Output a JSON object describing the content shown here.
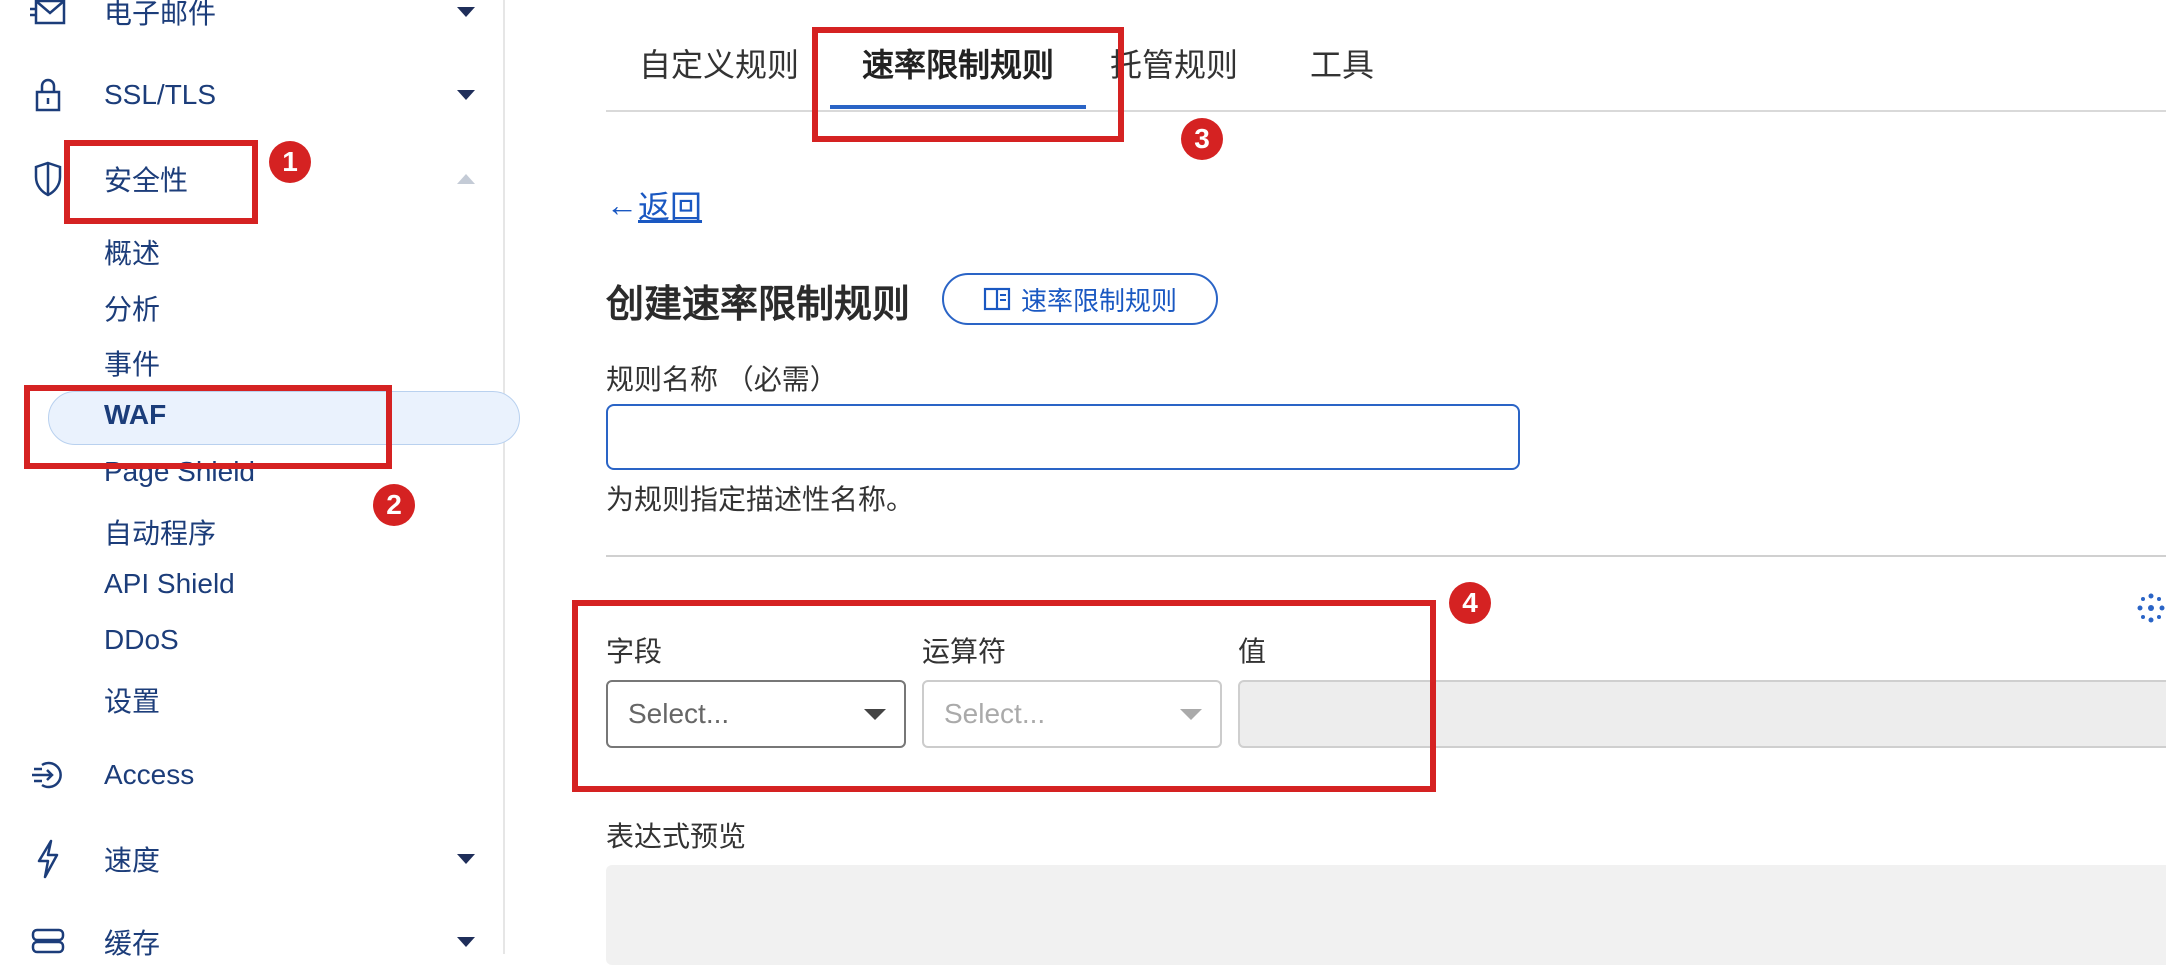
{
  "sidebar": {
    "items": [
      {
        "label": "电子邮件",
        "icon": "mail-icon"
      },
      {
        "label": "SSL/TLS",
        "icon": "lock-icon"
      },
      {
        "label": "安全性",
        "icon": "shield-icon"
      },
      {
        "label": "Access",
        "icon": "access-icon"
      },
      {
        "label": "速度",
        "icon": "lightning-icon"
      },
      {
        "label": "缓存",
        "icon": "cache-icon"
      }
    ],
    "security_subitems": [
      "概述",
      "分析",
      "事件",
      "WAF",
      "Page Shield",
      "自动程序",
      "API Shield",
      "DDoS",
      "设置"
    ],
    "active_subitem": "WAF"
  },
  "tabs": [
    "自定义规则",
    "速率限制规则",
    "托管规则",
    "工具"
  ],
  "active_tab": "速率限制规则",
  "back_link": {
    "arrow": "←",
    "label": "返回"
  },
  "page_title": "创建速率限制规则",
  "doc_button_label": "速率限制规则",
  "rule_name": {
    "label": "规则名称 （必需）",
    "value": "",
    "help": "为规则指定描述性名称。"
  },
  "expression": {
    "field_label": "字段",
    "operator_label": "运算符",
    "value_label": "值",
    "field_placeholder": "Select...",
    "operator_placeholder": "Select...",
    "preview_label": "表达式预览"
  },
  "annotations": [
    "1",
    "2",
    "3",
    "4"
  ],
  "colors": {
    "accent": "#2a64c6",
    "annotation": "#d52222",
    "nav_text": "#1c3d7a"
  }
}
